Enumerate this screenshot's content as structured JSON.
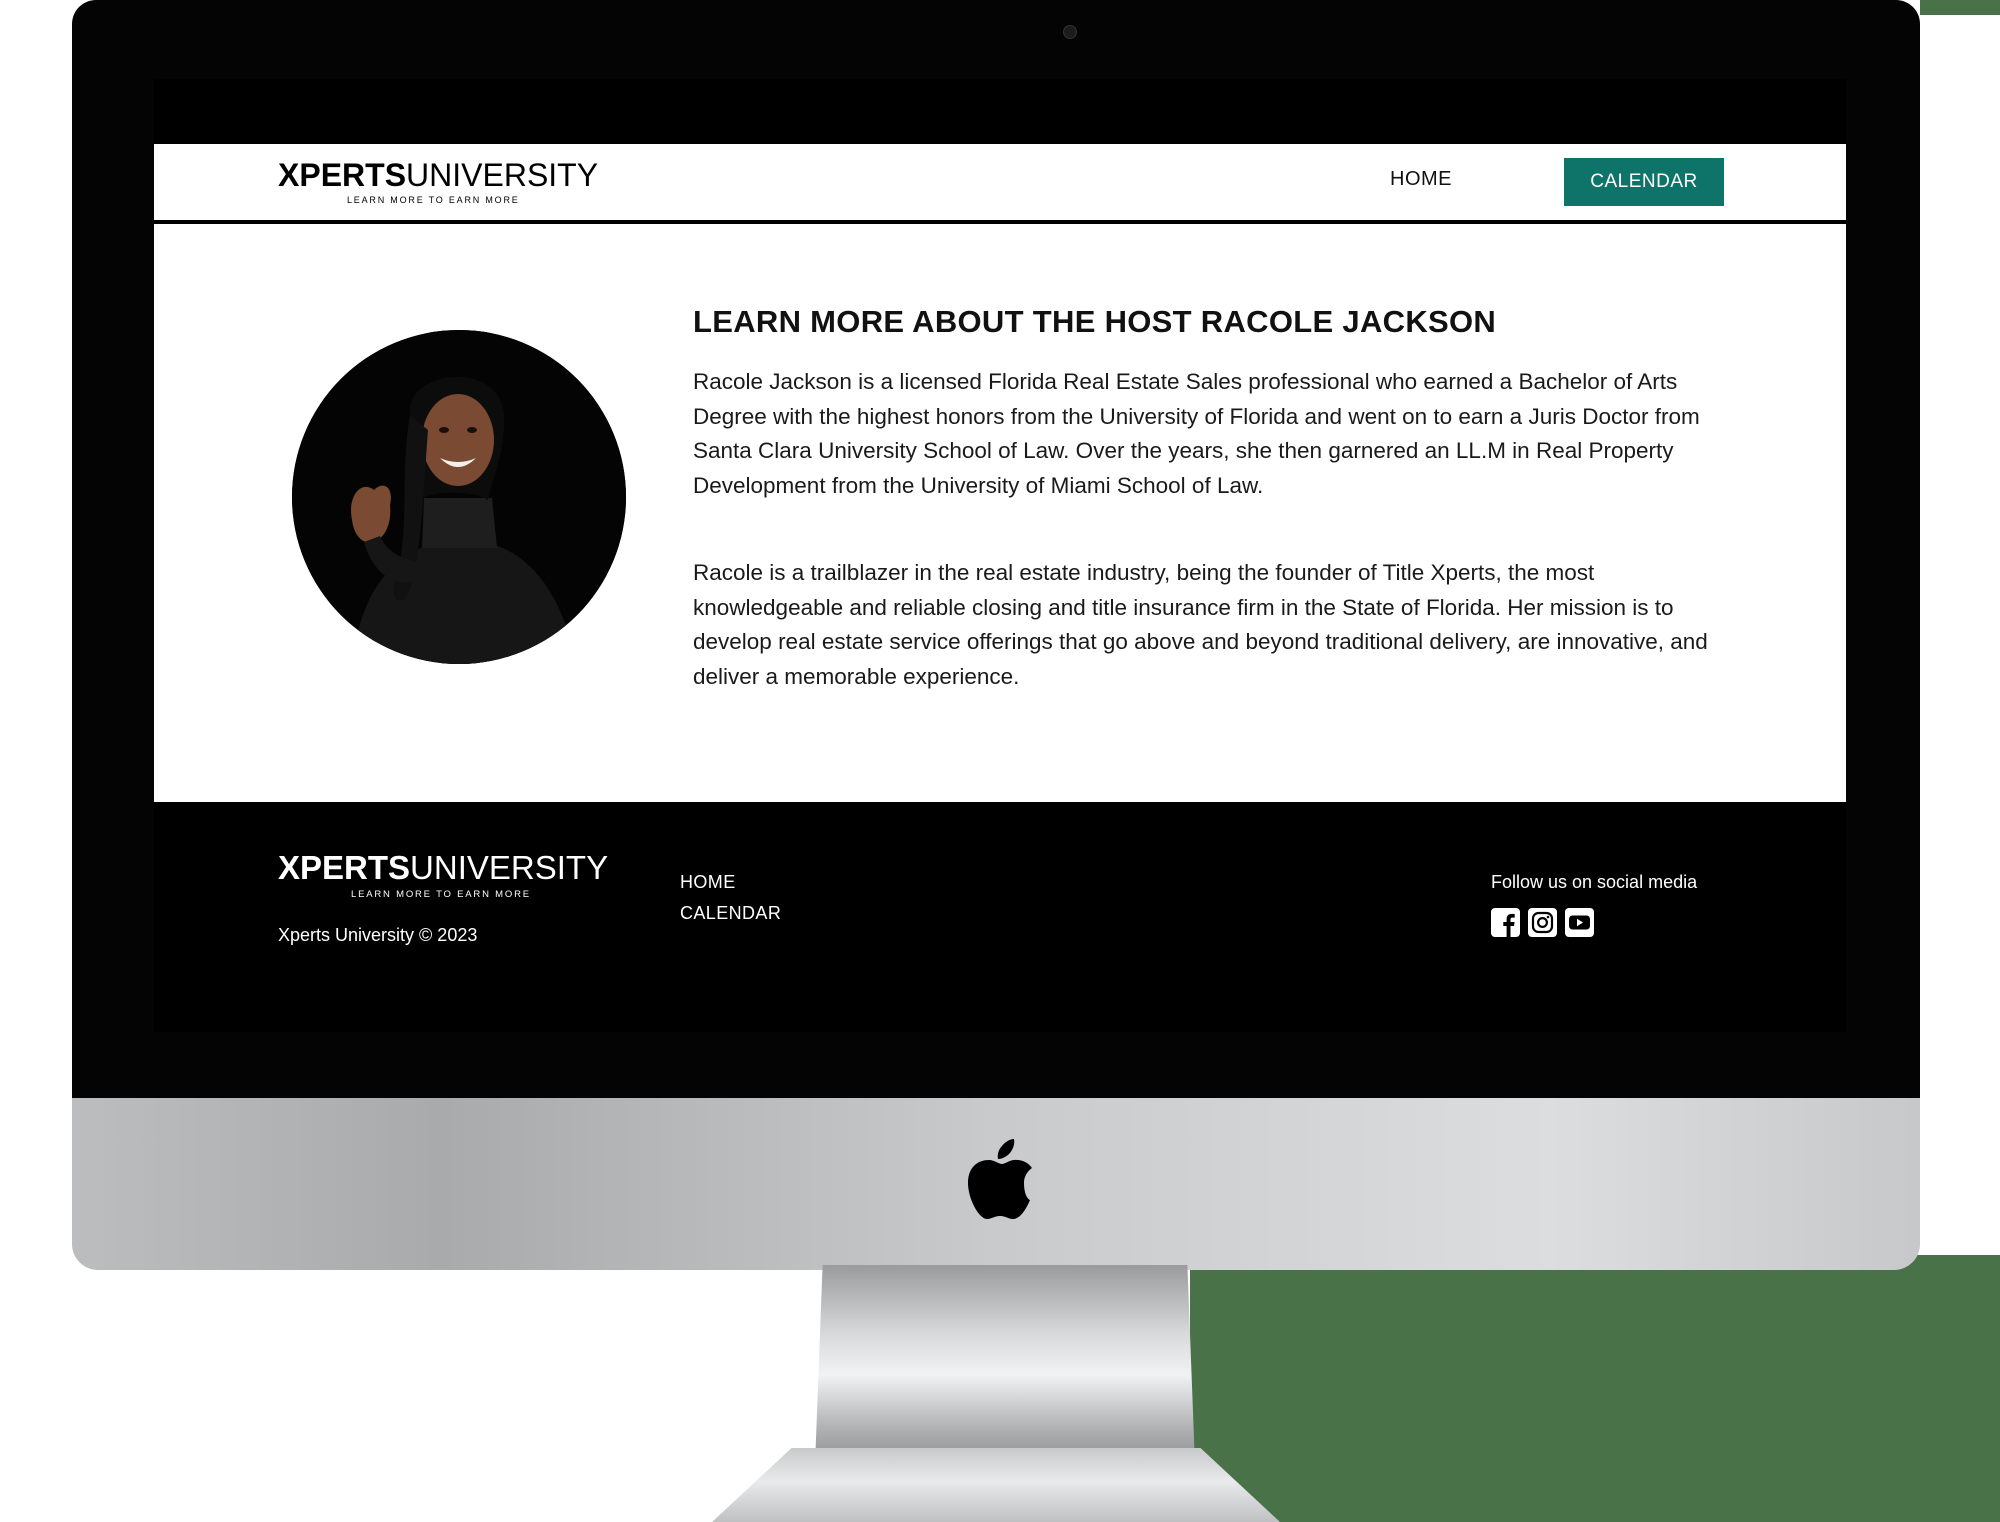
{
  "site": {
    "logo_bold": "XPERTS",
    "logo_light": "UNIVERSITY",
    "tagline": "LEARN MORE TO EARN MORE"
  },
  "nav": {
    "home_label": "HOME",
    "calendar_label": "CALENDAR",
    "accent_color": "#0e7469"
  },
  "main": {
    "heading": "LEARN MORE ABOUT THE HOST RACOLE JACKSON",
    "paragraphs": [
      "Racole Jackson is a licensed Florida Real Estate Sales professional who earned a Bachelor of Arts Degree with the highest honors from the University of Florida and went on to earn a Juris Doctor from Santa Clara University School of Law. Over the years, she then garnered an LL.M in Real Property Development from the University of Miami School of Law.",
      "Racole is a trailblazer in the real estate industry, being the founder of Title Xperts, the most knowledgeable and reliable closing and title insurance firm in the State of Florida. Her mission is to develop real estate service offerings that go above and beyond traditional delivery, are innovative, and deliver a memorable experience."
    ]
  },
  "footer": {
    "copyright": "Xperts University © 2023",
    "links": [
      "HOME",
      "CALENDAR"
    ],
    "follow_label": "Follow us on social media",
    "social_icons": [
      "facebook-icon",
      "instagram-icon",
      "youtube-icon"
    ]
  }
}
